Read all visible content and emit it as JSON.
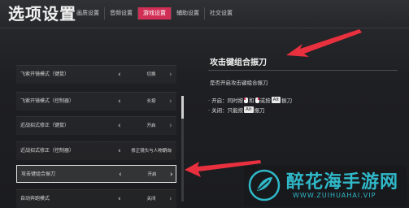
{
  "header": {
    "title": "选项设置",
    "tabs": [
      {
        "label": "画质设置"
      },
      {
        "label": "音频设置"
      },
      {
        "label": "游戏设置"
      },
      {
        "label": "辅助设置"
      },
      {
        "label": "社交设置"
      }
    ],
    "active_tab": "游戏设置"
  },
  "settings": {
    "rows": [
      {
        "label": "飞索开镜模式（键鼠）",
        "value": "切换"
      },
      {
        "label": "飞索开镜模式（控制器）",
        "value": "长按"
      },
      {
        "label": "近战招式修正（键鼠）",
        "value": "开启"
      },
      {
        "label": "近战招式修正（控制器）",
        "value": "修正镜头与人物朝向"
      },
      {
        "label": "攻击键组合振刀",
        "value": "开启"
      },
      {
        "label": "自动奔跑模式",
        "value": "关闭"
      }
    ],
    "arrow_left": "‹",
    "arrow_right": "›"
  },
  "detail": {
    "title": "攻击键组合振刀",
    "description": "是否开启攻击键组合振刀",
    "on_prefix": "· 开启：同时按",
    "on_and": "和",
    "on_or": "或按",
    "on_key": "Alt",
    "on_suffix": "振刀",
    "off_prefix": "· 关闭：只能按",
    "off_key": "Alt",
    "off_suffix": "振刀"
  },
  "watermark": {
    "name": "醉花海手游网",
    "url": "WWW.ZUIHUAHAI.VIP"
  },
  "colors": {
    "accent": "#d12e55",
    "annotation_arrow": "#e8303e",
    "watermark": "#2fb9c9"
  }
}
